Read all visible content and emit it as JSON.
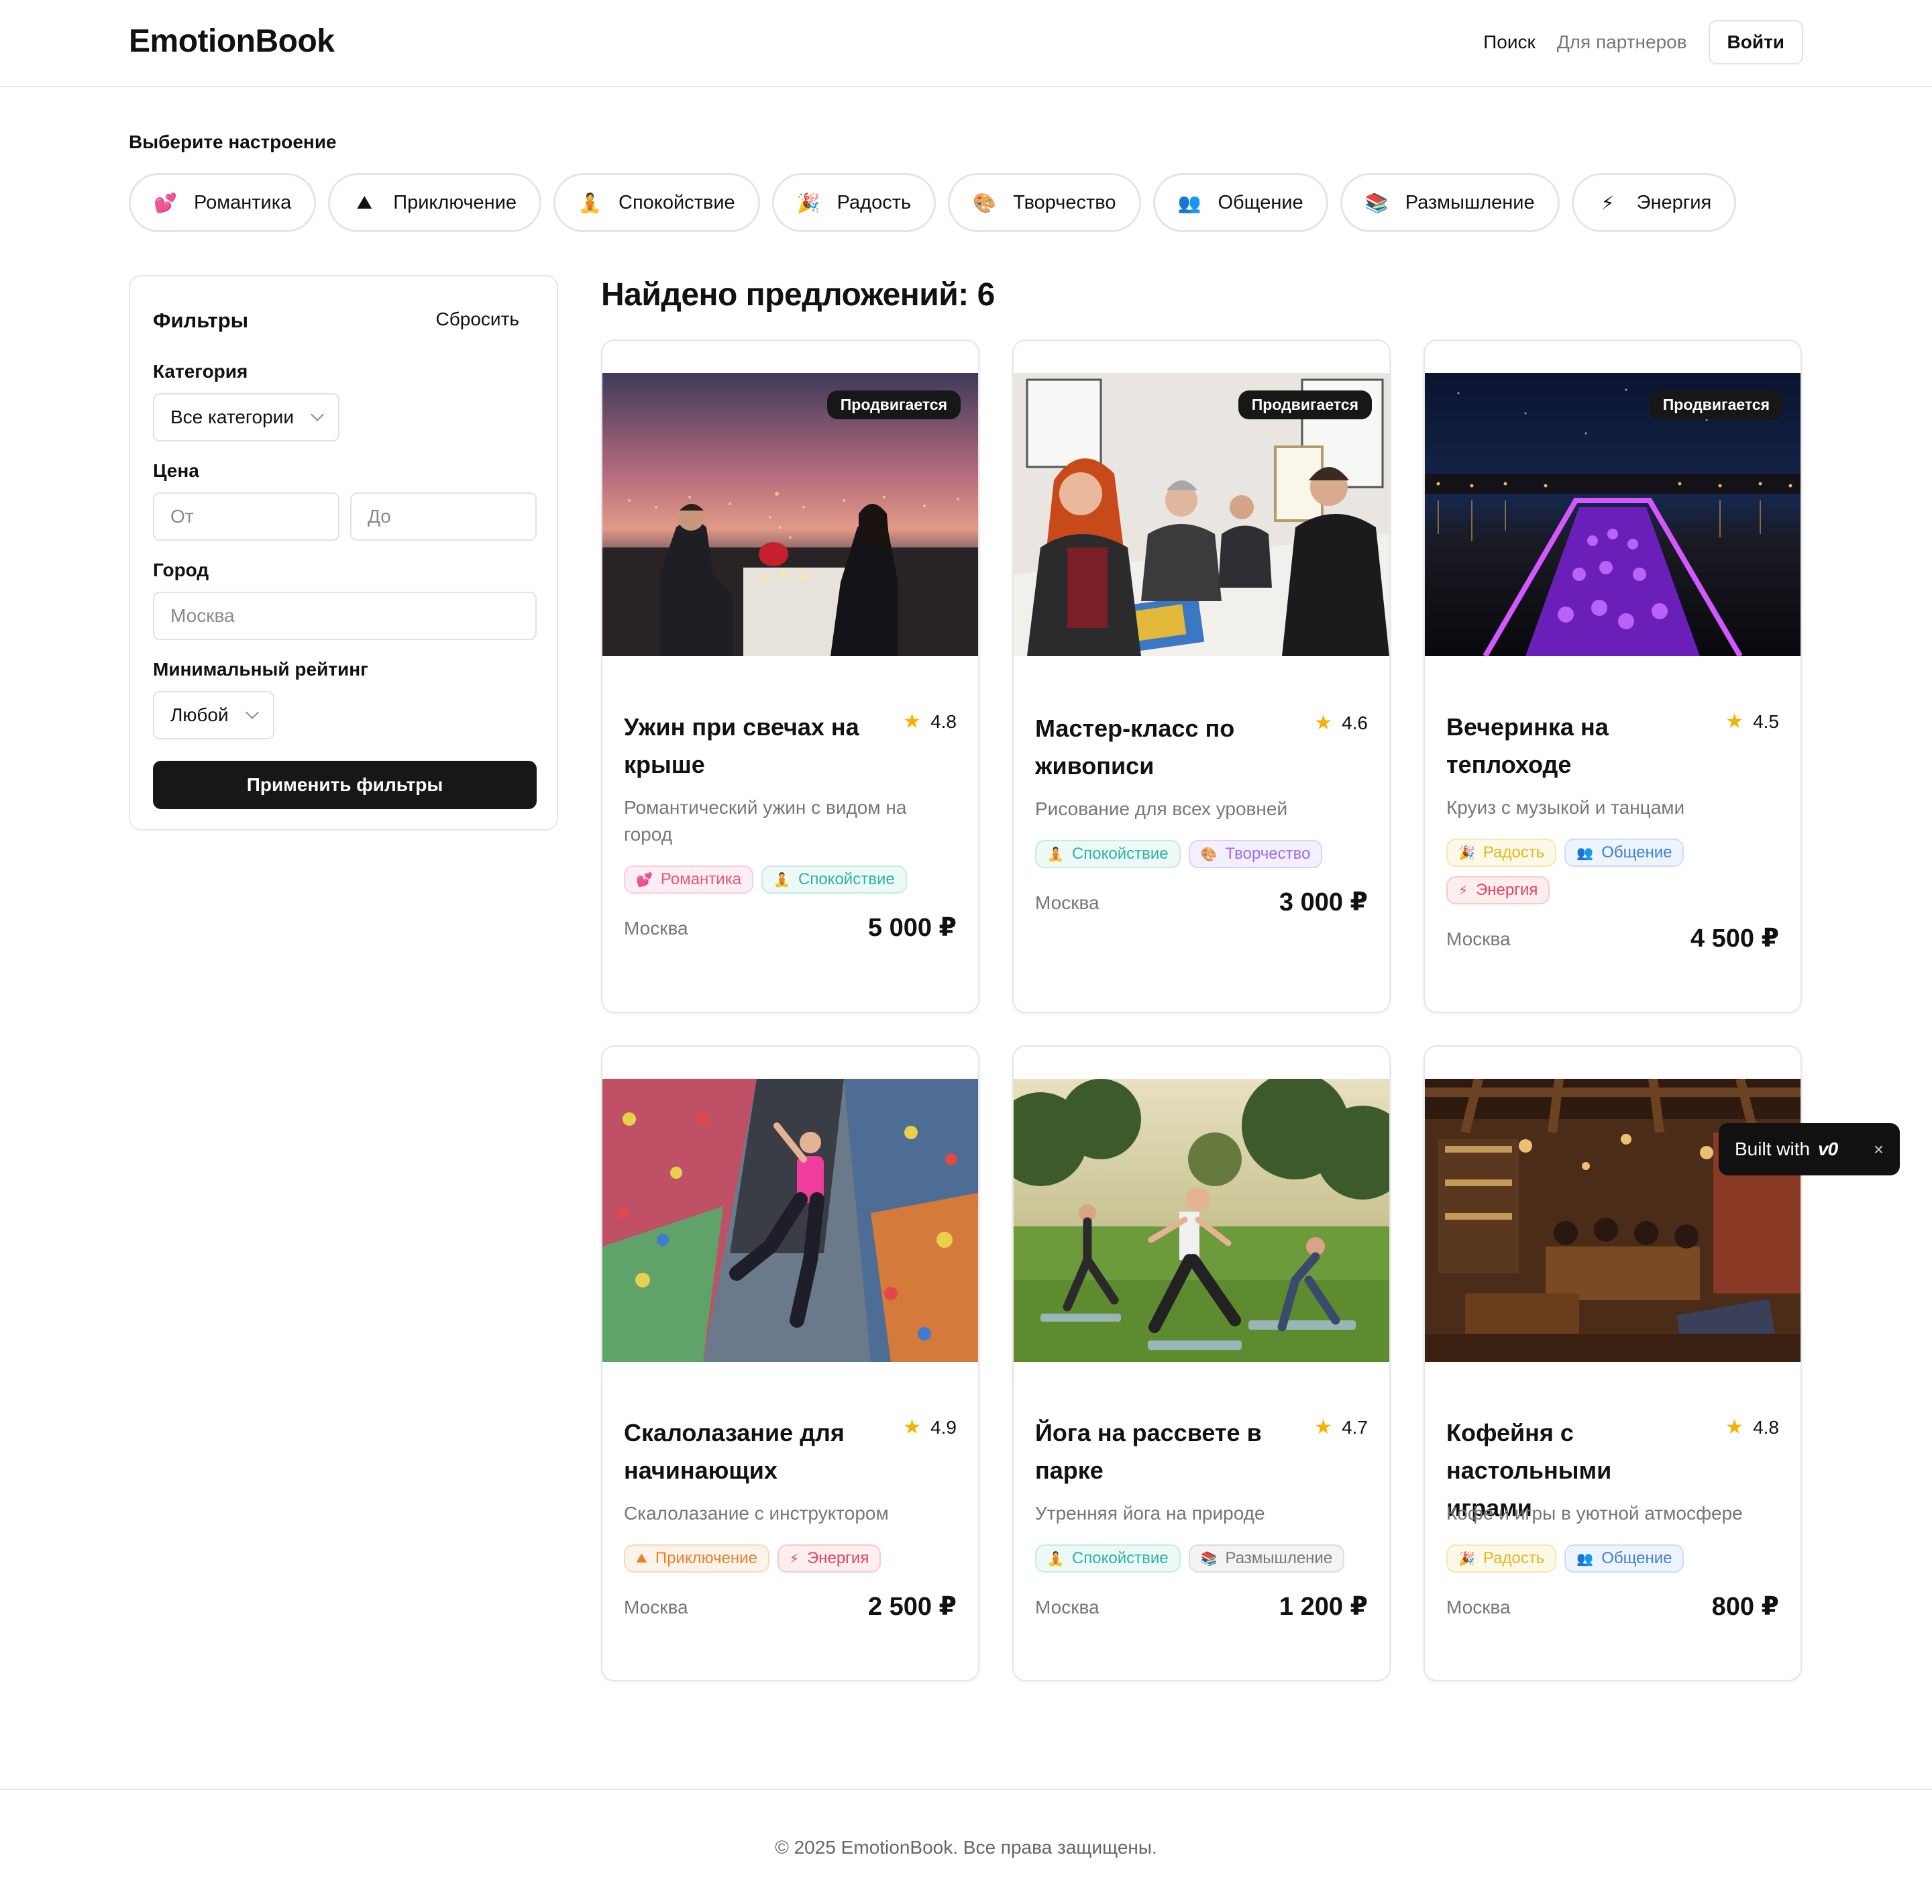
{
  "header": {
    "logo": "EmotionBook",
    "nav": {
      "search": "Поиск",
      "partners": "Для партнеров",
      "login": "Войти"
    }
  },
  "mood": {
    "title": "Выберите настроение",
    "chips": [
      {
        "emoji": "💕",
        "label": "Романтика"
      },
      {
        "emoji": "⛰",
        "label": "Приключение"
      },
      {
        "emoji": "🧘",
        "label": "Спокойствие"
      },
      {
        "emoji": "🎉",
        "label": "Радость"
      },
      {
        "emoji": "🎨",
        "label": "Творчество"
      },
      {
        "emoji": "👥",
        "label": "Общение"
      },
      {
        "emoji": "📚",
        "label": "Размышление"
      },
      {
        "emoji": "⚡",
        "label": "Энергия"
      }
    ]
  },
  "filters": {
    "title": "Фильтры",
    "reset": "Сбросить",
    "category_label": "Категория",
    "category_value": "Все категории",
    "price_label": "Цена",
    "price_from_placeholder": "От",
    "price_to_placeholder": "До",
    "city_label": "Город",
    "city_placeholder": "Москва",
    "rating_label": "Минимальный рейтинг",
    "rating_value": "Любой",
    "apply": "Применить фильтры"
  },
  "results": {
    "title": "Найдено предложений: 6",
    "badge": "Продвигается",
    "cards": [
      {
        "title": "Ужин при свечах на крыше",
        "rating": "4.8",
        "desc": "Романтический ужин с видом на город",
        "tags": [
          {
            "emoji": "💕",
            "label": "Романтика",
            "color": "#e8557f",
            "bg": "#fdeef3",
            "border": "#f8cfdc"
          },
          {
            "emoji": "🧘",
            "label": "Спокойствие",
            "color": "#2bb5a3",
            "bg": "#ecf9f6",
            "border": "#c4ece4"
          }
        ],
        "city": "Москва",
        "price": "5 000 ₽",
        "promoted": true
      },
      {
        "title": "Мастер-класс по живописи",
        "rating": "4.6",
        "desc": "Рисование для всех уровней",
        "tags": [
          {
            "emoji": "🧘",
            "label": "Спокойствие",
            "color": "#2bb5a3",
            "bg": "#ecf9f6",
            "border": "#c4ece4"
          },
          {
            "emoji": "🎨",
            "label": "Творчество",
            "color": "#9b6cf0",
            "bg": "#f4effd",
            "border": "#ddd0f9"
          }
        ],
        "city": "Москва",
        "price": "3 000 ₽",
        "promoted": true
      },
      {
        "title": "Вечеринка на теплоходе",
        "rating": "4.5",
        "desc": "Круиз с музыкой и танцами",
        "tags": [
          {
            "emoji": "🎉",
            "label": "Радость",
            "color": "#e3b81a",
            "bg": "#fdf9e8",
            "border": "#f6e8b0"
          },
          {
            "emoji": "👥",
            "label": "Общение",
            "color": "#3d7fd9",
            "bg": "#edf4fd",
            "border": "#cadff8"
          },
          {
            "emoji": "⚡",
            "label": "Энергия",
            "color": "#e2465a",
            "bg": "#fdeef0",
            "border": "#f7c9cf"
          }
        ],
        "city": "Москва",
        "price": "4 500 ₽",
        "promoted": true
      },
      {
        "title": "Скалолазание для начинающих",
        "rating": "4.9",
        "desc": "Скалолазание с инструктором",
        "tags": [
          {
            "emoji": "⛰",
            "label": "Приключение",
            "color": "#e7822a",
            "bg": "#fdf3ea",
            "border": "#f7d9bd"
          },
          {
            "emoji": "⚡",
            "label": "Энергия",
            "color": "#e2465a",
            "bg": "#fdeef0",
            "border": "#f7c9cf"
          }
        ],
        "city": "Москва",
        "price": "2 500 ₽",
        "promoted": false
      },
      {
        "title": "Йога на рассвете в парке",
        "rating": "4.7",
        "desc": "Утренняя йога на природе",
        "tags": [
          {
            "emoji": "🧘",
            "label": "Спокойствие",
            "color": "#2bb5a3",
            "bg": "#ecf9f6",
            "border": "#c4ece4"
          },
          {
            "emoji": "📚",
            "label": "Размышление",
            "color": "#777777",
            "bg": "#f3f3f3",
            "border": "#dddddd"
          }
        ],
        "city": "Москва",
        "price": "1 200 ₽",
        "promoted": false
      },
      {
        "title": "Кофейня с настольными играми",
        "rating": "4.8",
        "desc": "Кофе и игры в уютной атмосфере",
        "tags": [
          {
            "emoji": "🎉",
            "label": "Радость",
            "color": "#e3b81a",
            "bg": "#fdf9e8",
            "border": "#f6e8b0"
          },
          {
            "emoji": "👥",
            "label": "Общение",
            "color": "#3d7fd9",
            "bg": "#edf4fd",
            "border": "#cadff8"
          }
        ],
        "city": "Москва",
        "price": "800 ₽",
        "promoted": false
      }
    ]
  },
  "built_with": {
    "text": "Built with",
    "brand": "v0",
    "close": "×"
  },
  "footer": {
    "text": "© 2025 EmotionBook. Все права защищены."
  }
}
